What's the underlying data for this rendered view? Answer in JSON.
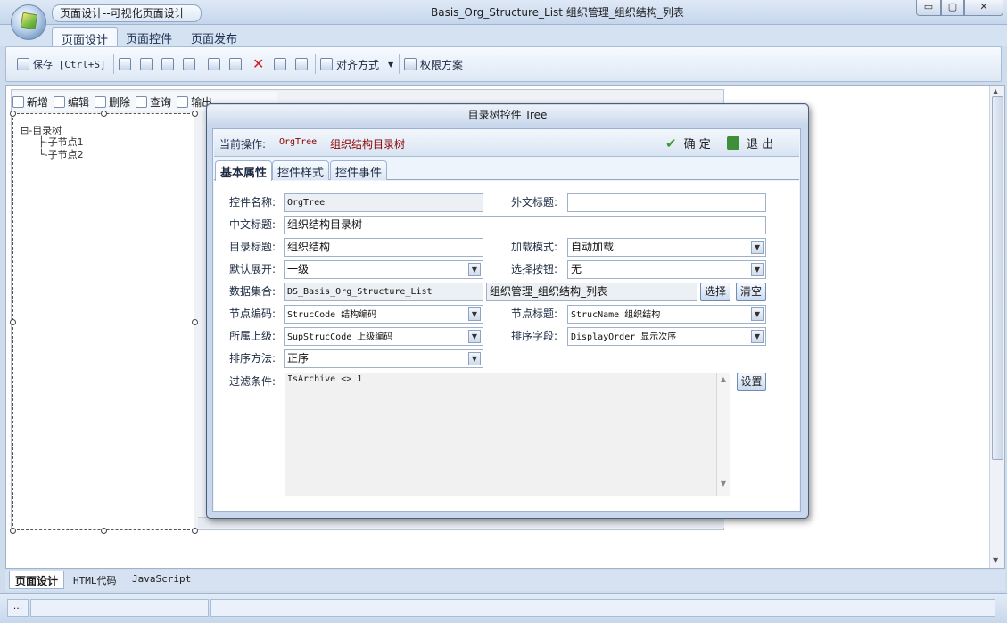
{
  "window": {
    "doc_title": "Basis_Org_Structure_List  组织管理_组织结构_列表",
    "min_label": "▭",
    "max_label": "▢",
    "close_label": "✕"
  },
  "quick_access_title": "页面设计--可视化页面设计",
  "ribbon_tabs": [
    "页面设计",
    "页面控件",
    "页面发布"
  ],
  "toolbar": {
    "save_label": "保存 [Ctrl+S]",
    "align_label": "对齐方式",
    "permission_label": "权限方案"
  },
  "grid_toolbar": [
    "新增",
    "编辑",
    "删除",
    "查询",
    "输出"
  ],
  "tree": {
    "root": "目录树",
    "children": [
      "子节点1",
      "子节点2"
    ]
  },
  "dialog": {
    "title": "目录树控件 Tree",
    "op_label": "当前操作:",
    "op_code": "OrgTree",
    "op_name": "组织结构目录树",
    "ok_label": "确 定",
    "exit_label": "退 出",
    "tabs": [
      "基本属性",
      "控件样式",
      "控件事件"
    ],
    "fields": {
      "control_name_label": "控件名称:",
      "control_name": "OrgTree",
      "foreign_title_label": "外文标题:",
      "foreign_title": "",
      "cn_title_label": "中文标题:",
      "cn_title": "组织结构目录树",
      "dir_title_label": "目录标题:",
      "dir_title": "组织结构",
      "load_mode_label": "加载模式:",
      "load_mode": "自动加载",
      "default_expand_label": "默认展开:",
      "default_expand": "一级",
      "select_button_label": "选择按钮:",
      "select_button": "无",
      "dataset_label": "数据集合:",
      "dataset_code": "DS_Basis_Org_Structure_List",
      "dataset_name": "组织管理_组织结构_列表",
      "choose_label": "选择",
      "clear_label": "清空",
      "node_code_label": "节点编码:",
      "node_code": "StrucCode  结构编码",
      "node_title_label": "节点标题:",
      "node_title": "StrucName  组织结构",
      "parent_label": "所属上级:",
      "parent": "SupStrucCode  上级编码",
      "sort_field_label": "排序字段:",
      "sort_field": "DisplayOrder  显示次序",
      "sort_method_label": "排序方法:",
      "sort_method": "正序",
      "filter_label": "过滤条件:",
      "filter": "IsArchive <> 1",
      "settings_label": "设置"
    }
  },
  "bottom_tabs": [
    "页面设计",
    "HTML代码",
    "JavaScript"
  ],
  "status": {
    "cell1": "..."
  },
  "scroll_glyphs": {
    "up": "▲",
    "down": "▼",
    "grip": "≡",
    "dropdown": "▼"
  }
}
